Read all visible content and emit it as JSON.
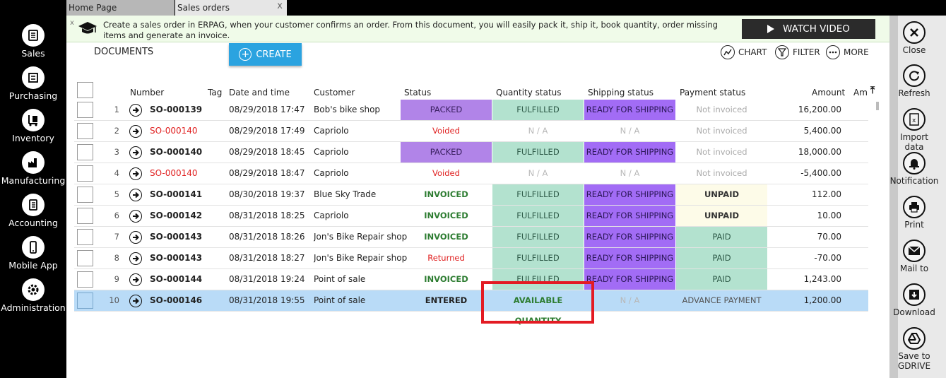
{
  "tabs": {
    "home": "Home Page",
    "sales": "Sales orders",
    "close": "x"
  },
  "nav": [
    {
      "label": "Sales",
      "icon": "sales-icon"
    },
    {
      "label": "Purchasing",
      "icon": "purchasing-icon"
    },
    {
      "label": "Inventory",
      "icon": "inventory-icon"
    },
    {
      "label": "Manufacturing",
      "icon": "manufacturing-icon"
    },
    {
      "label": "Accounting",
      "icon": "accounting-icon"
    },
    {
      "label": "Mobile App",
      "icon": "mobile-icon"
    },
    {
      "label": "Administration",
      "icon": "gear-icon"
    }
  ],
  "info": {
    "text": "Create a sales order in ERPAG, when your customer confirms an order. From this document, you will easily pack it, ship it, book quantity, order missing items and generate an invoice.",
    "close": "x",
    "watch_video": "WATCH VIDEO"
  },
  "toolbar": {
    "documents": "DOCUMENTS",
    "create": "CREATE",
    "chart": "CHART",
    "filter": "FILTER",
    "more": "MORE"
  },
  "headers": {
    "number": "Number",
    "tag": "Tag",
    "date": "Date and time",
    "customer": "Customer",
    "status": "Status",
    "qty_status": "Quantity status",
    "ship_status": "Shipping status",
    "pay_status": "Payment status",
    "amount": "Amount",
    "amount2": "Amo"
  },
  "colors": {
    "packed": "#b184e8",
    "fulfilled": "#b3e2cf",
    "ready": "#a26cf5",
    "unpaid": "#fdfbe8",
    "paid": "#b3e2cf",
    "voided": "#e02020",
    "invoiced": "#2e7d32",
    "selected": "#b9dbf7",
    "highlight": "#e31b23"
  },
  "rows": [
    {
      "n": "1",
      "number": "SO-000139",
      "red": false,
      "date": "08/29/2018 17:47",
      "customer": "Bob's bike shop",
      "status": "PACKED",
      "status_kind": "packed",
      "qty": "FULFILLED",
      "qty_kind": "fulfilled",
      "ship": "READY FOR SHIPPING",
      "ship_kind": "ready",
      "pay": "Not invoiced",
      "pay_kind": "grey",
      "amount": "16,200.00"
    },
    {
      "n": "2",
      "number": "SO-000140",
      "red": true,
      "date": "08/29/2018 17:49",
      "customer": "Capriolo",
      "status": "Voided",
      "status_kind": "voided",
      "qty": "N / A",
      "qty_kind": "na",
      "ship": "N / A",
      "ship_kind": "na",
      "pay": "Not invoiced",
      "pay_kind": "grey",
      "amount": "5,400.00"
    },
    {
      "n": "3",
      "number": "SO-000140",
      "red": false,
      "date": "08/29/2018 18:45",
      "customer": "Capriolo",
      "status": "PACKED",
      "status_kind": "packed",
      "qty": "FULFILLED",
      "qty_kind": "fulfilled",
      "ship": "READY FOR SHIPPING",
      "ship_kind": "ready",
      "pay": "Not invoiced",
      "pay_kind": "grey",
      "amount": "18,000.00"
    },
    {
      "n": "4",
      "number": "SO-000140",
      "red": true,
      "date": "08/29/2018 18:47",
      "customer": "Capriolo",
      "status": "Voided",
      "status_kind": "voided",
      "qty": "N / A",
      "qty_kind": "na",
      "ship": "N / A",
      "ship_kind": "na",
      "pay": "Not invoiced",
      "pay_kind": "grey",
      "amount": "-5,400.00"
    },
    {
      "n": "5",
      "number": "SO-000141",
      "red": false,
      "date": "08/30/2018 19:37",
      "customer": "Blue Sky Trade",
      "status": "INVOICED",
      "status_kind": "invoiced",
      "qty": "FULFILLED",
      "qty_kind": "fulfilled",
      "ship": "READY FOR SHIPPING",
      "ship_kind": "ready",
      "pay": "UNPAID",
      "pay_kind": "unpaid",
      "amount": "112.00"
    },
    {
      "n": "6",
      "number": "SO-000142",
      "red": false,
      "date": "08/31/2018 18:25",
      "customer": "Capriolo",
      "status": "INVOICED",
      "status_kind": "invoiced",
      "qty": "FULFILLED",
      "qty_kind": "fulfilled",
      "ship": "READY FOR SHIPPING",
      "ship_kind": "ready",
      "pay": "UNPAID",
      "pay_kind": "unpaid",
      "amount": "10.00"
    },
    {
      "n": "7",
      "number": "SO-000143",
      "red": false,
      "date": "08/31/2018 18:26",
      "customer": "Jon's Bike Repair shop",
      "status": "INVOICED",
      "status_kind": "invoiced",
      "qty": "FULFILLED",
      "qty_kind": "fulfilled",
      "ship": "READY FOR SHIPPING",
      "ship_kind": "ready",
      "pay": "PAID",
      "pay_kind": "paid",
      "amount": "70.00"
    },
    {
      "n": "8",
      "number": "SO-000143",
      "red": false,
      "date": "08/31/2018 18:27",
      "customer": "Jon's Bike Repair shop",
      "status": "Returned",
      "status_kind": "voided",
      "qty": "FULFILLED",
      "qty_kind": "fulfilled",
      "ship": "READY FOR SHIPPING",
      "ship_kind": "ready",
      "pay": "PAID",
      "pay_kind": "paid",
      "amount": "-70.00"
    },
    {
      "n": "9",
      "number": "SO-000144",
      "red": false,
      "date": "08/31/2018 19:24",
      "customer": "Point of sale",
      "status": "INVOICED",
      "status_kind": "invoiced",
      "qty": "FULFILLED",
      "qty_kind": "fulfilled",
      "ship": "READY FOR SHIPPING",
      "ship_kind": "ready",
      "pay": "PAID",
      "pay_kind": "paid",
      "amount": "1,243.00"
    },
    {
      "n": "10",
      "number": "SO-000146",
      "red": false,
      "selected": true,
      "date": "08/31/2018 19:55",
      "customer": "Point of sale",
      "status": "ENTERED",
      "status_kind": "entered",
      "qty": "AVAILABLE QUANTITY",
      "qty_kind": "available",
      "ship": "N / A",
      "ship_kind": "na",
      "pay": "ADVANCE PAYMENT",
      "pay_kind": "advance",
      "amount": "1,200.00"
    }
  ],
  "right": [
    {
      "label": "Close",
      "icon": "close-icon"
    },
    {
      "label": "Refresh",
      "icon": "refresh-icon"
    },
    {
      "label": "Import data",
      "icon": "import-icon"
    },
    {
      "label": "Notification",
      "icon": "bell-icon"
    },
    {
      "label": "Print",
      "icon": "print-icon"
    },
    {
      "label": "Mail to",
      "icon": "mail-icon"
    },
    {
      "label": "Download",
      "icon": "download-icon"
    },
    {
      "label": "Save to GDRIVE",
      "icon": "gdrive-icon"
    }
  ]
}
